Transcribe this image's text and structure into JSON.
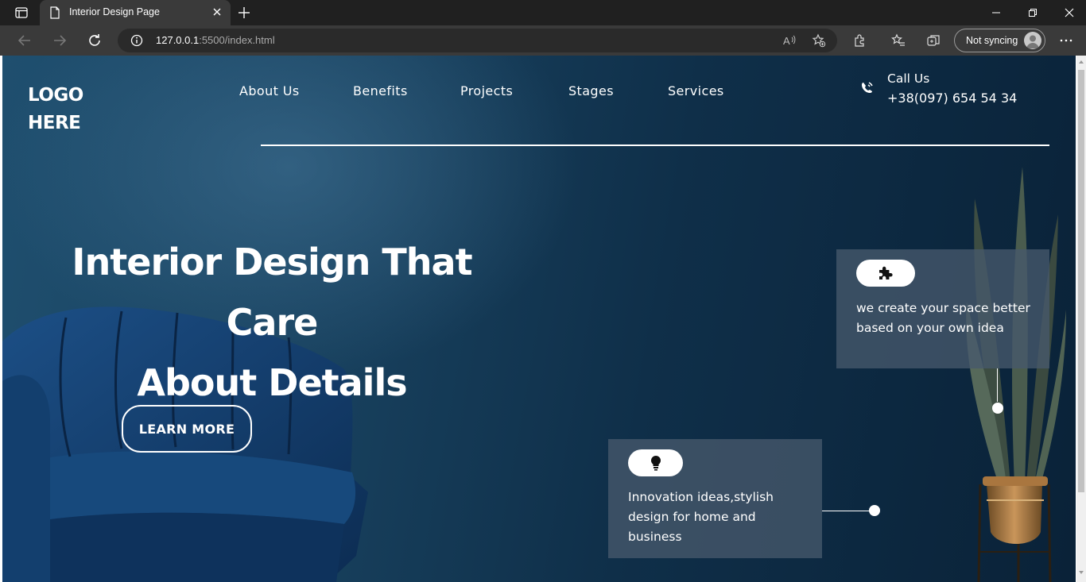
{
  "browser": {
    "tab_title": "Interior Design Page",
    "url_host": "127.0.0.1",
    "url_path": ":5500/index.html",
    "sync_label": "Not syncing",
    "icons": [
      "tab-actions-icon",
      "page-icon",
      "close-icon",
      "plus-icon",
      "minimize-icon",
      "maximize-icon",
      "window-close-icon",
      "back-arrow-icon",
      "forward-arrow-icon",
      "refresh-icon",
      "info-icon",
      "read-aloud-icon",
      "add-favorite-icon",
      "extensions-icon",
      "favorites-icon",
      "collections-icon",
      "profile-icon",
      "more-icon"
    ]
  },
  "page": {
    "logo_line1": "LOGO",
    "logo_line2": "HERE",
    "nav": [
      "About Us",
      "Benefits",
      "Projects",
      "Stages",
      "Services"
    ],
    "call_label": "Call Us",
    "call_number": "+38(097) 654 54 34",
    "headline_line1": "Interior Design That Care",
    "headline_line2": "About Details",
    "cta_label": "LEARN MORE",
    "card1_text": "we create your space better based on your own idea",
    "card2_text": "Innovation ideas,stylish design for home and business",
    "colors": {
      "hero_dark": "#0a2238",
      "hero_light": "#1f4f6f",
      "card_bg": "#46586c",
      "text": "#ffffff"
    }
  }
}
